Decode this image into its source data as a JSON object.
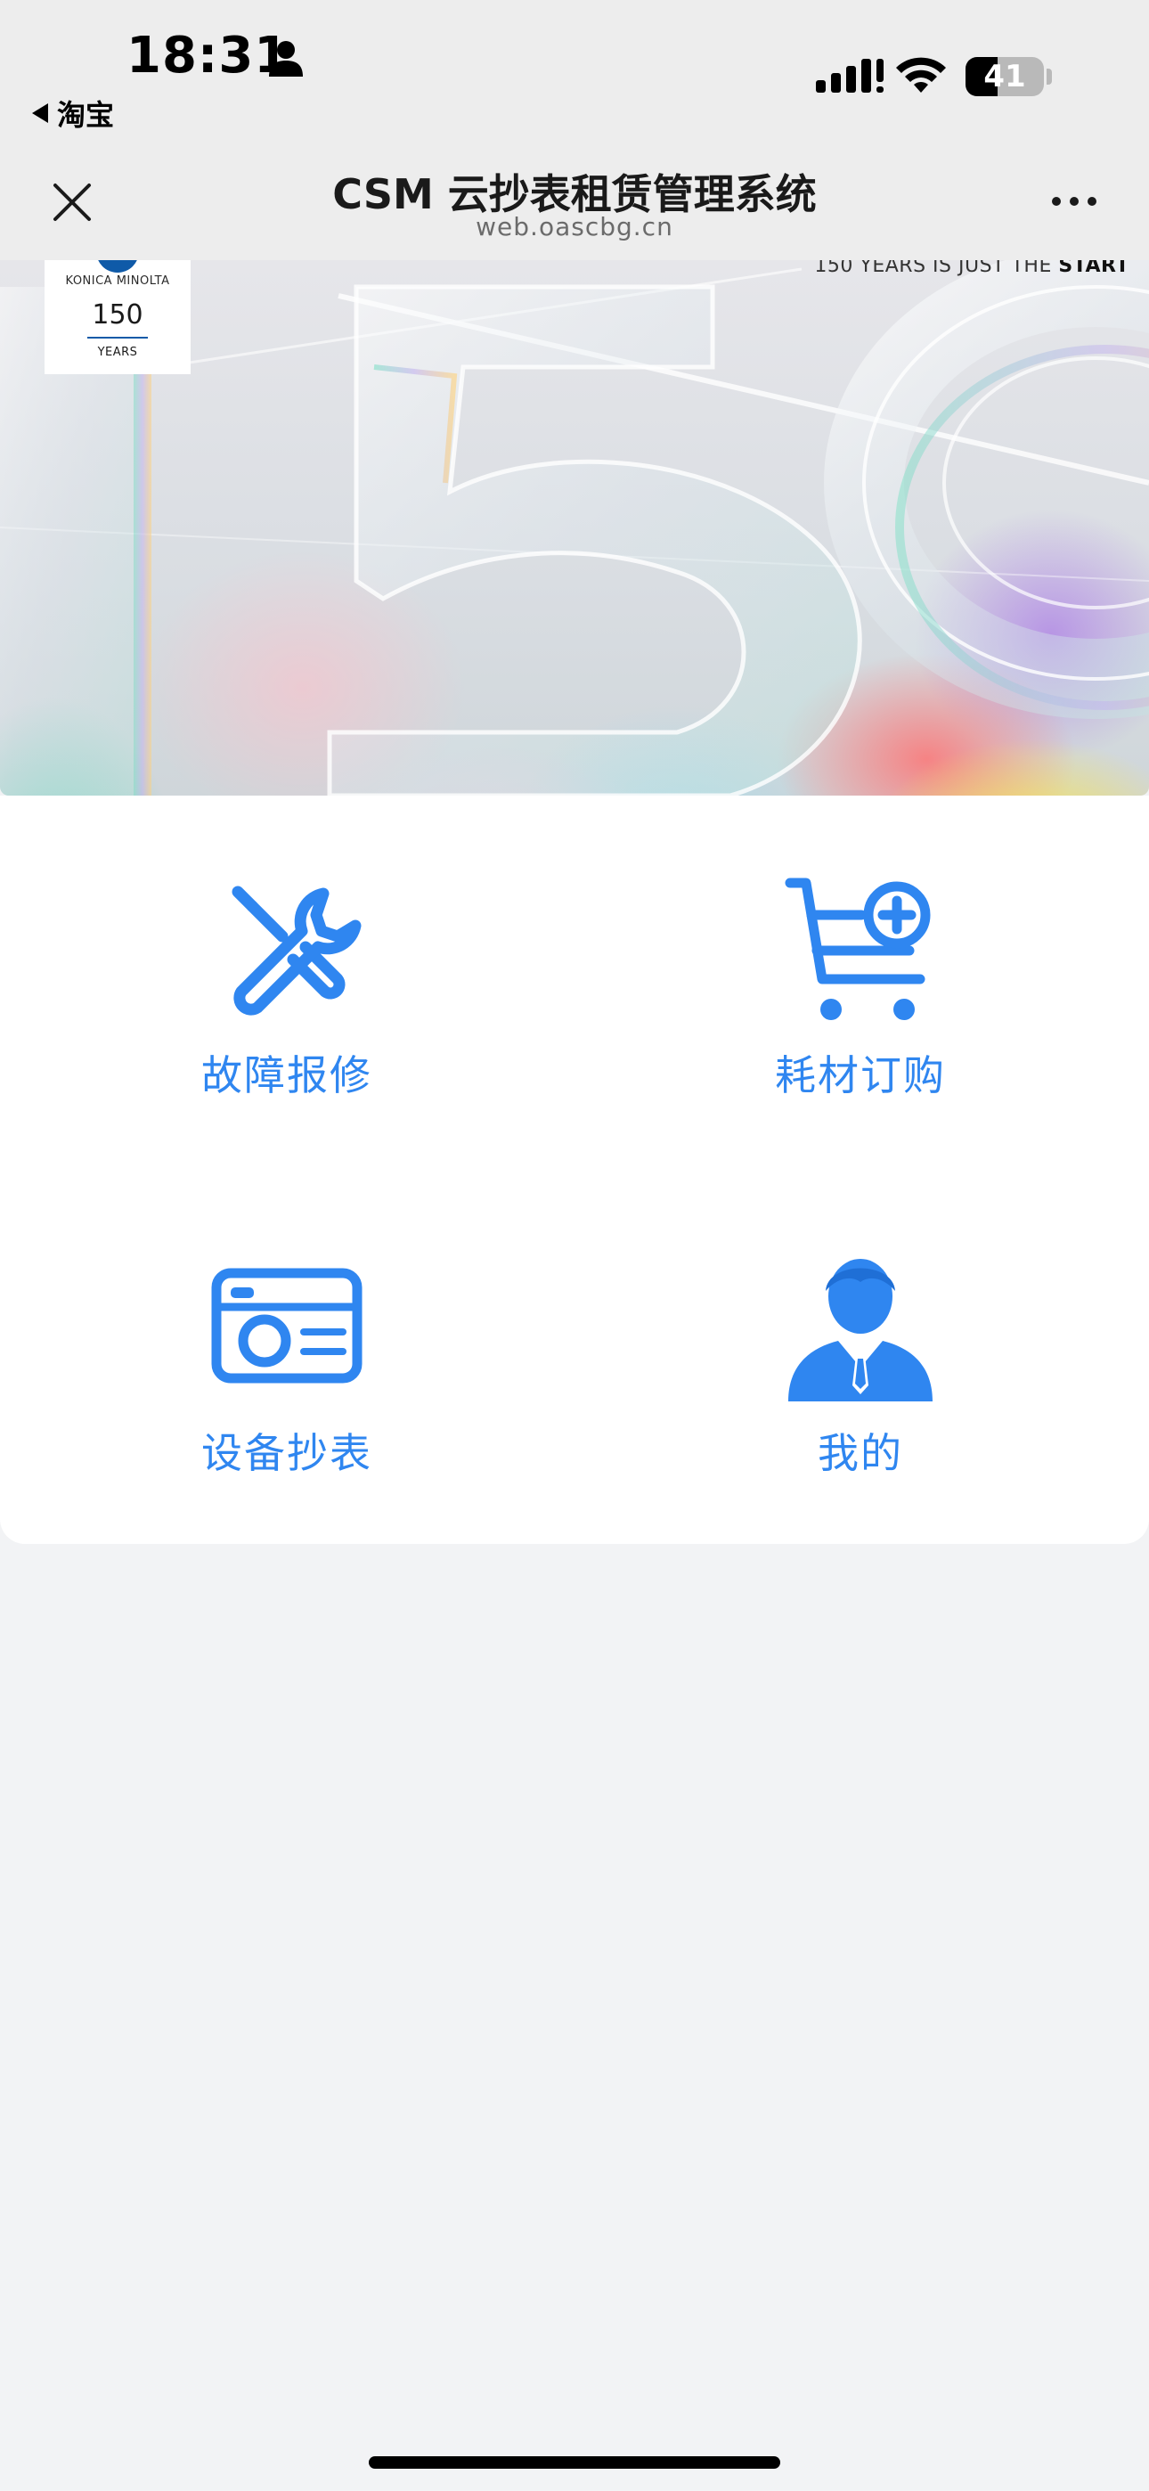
{
  "status_bar": {
    "time": "18:31",
    "back_app": "淘宝",
    "battery_percent": 41,
    "battery_label": "41"
  },
  "nav": {
    "title": "CSM 云抄表租赁管理系统",
    "subtitle": "web.oascbg.cn"
  },
  "banner": {
    "logo_brand": "KONICA MINOLTA",
    "logo_number": "150",
    "logo_years": "YEARS",
    "tagline_prefix": "150 YEARS IS JUST THE ",
    "tagline_emphasis": "START",
    "art_text": "150"
  },
  "menu": {
    "items": [
      {
        "label": "故障报修",
        "icon": "wrench-screwdriver-icon"
      },
      {
        "label": "耗材订购",
        "icon": "cart-plus-icon"
      },
      {
        "label": "设备抄表",
        "icon": "meter-card-icon"
      },
      {
        "label": "我的",
        "icon": "user-profile-icon"
      }
    ]
  },
  "colors": {
    "accent": "#2f86f0",
    "page_background": "#f2f3f5",
    "bar_background": "#ededed"
  }
}
